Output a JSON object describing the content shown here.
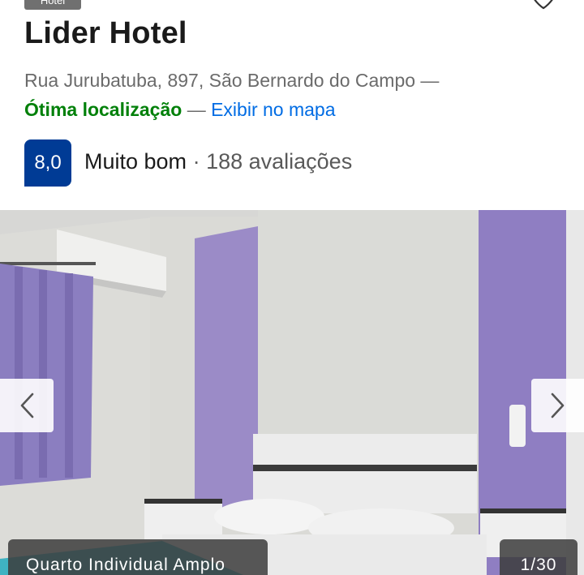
{
  "listing": {
    "type_badge": "Hotel",
    "name": "Lider Hotel",
    "address": "Rua Jurubatuba, 897, São Bernardo do Campo —",
    "location_quality": "Ótima localização",
    "separator": "—",
    "map_link": "Exibir no mapa",
    "score": "8,0",
    "rating_word": "Muito bom",
    "reviews": "· 188 avaliações"
  },
  "gallery": {
    "caption": "Quarto Individual Amplo",
    "counter": "1/30"
  },
  "icons": {
    "favorite": "heart-icon",
    "prev": "chevron-left-icon",
    "next": "chevron-right-icon"
  },
  "colors": {
    "score_bg": "#003b95",
    "good_location": "#008009",
    "link": "#006ce4"
  }
}
